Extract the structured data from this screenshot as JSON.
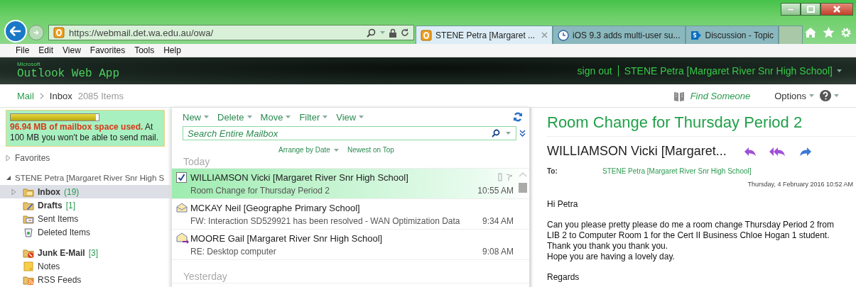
{
  "browser": {
    "address_host": "https://webmail.det.wa.edu.au/owa/",
    "tabs": [
      {
        "label": "STENE Petra [Margaret ...",
        "selected": true,
        "kind": "outlook"
      },
      {
        "label": "iOS 9.3 adds multi-user su...",
        "selected": false,
        "kind": "clock"
      },
      {
        "label": "Discussion - Topic",
        "selected": false,
        "kind": "sharepoint"
      }
    ],
    "menu": [
      "File",
      "Edit",
      "View",
      "Favorites",
      "Tools",
      "Help"
    ]
  },
  "app": {
    "brand_small": "Microsoft",
    "brand": "Outlook Web App",
    "sign_out": "sign out",
    "user": "STENE Petra [Margaret River Snr High School]"
  },
  "breadcrumb": {
    "root": "Mail",
    "folder": "Inbox",
    "count": "2085 Items"
  },
  "top_links": {
    "find": "Find Someone",
    "options": "Options"
  },
  "quota": {
    "level": 0.97,
    "warning": "**96.94 MB of mailbox space used.** At 100 MB you won't be able to send mail."
  },
  "sidebar": {
    "favorites": {
      "label": "Favorites",
      "expanded": false
    },
    "mailbox": {
      "label": "STENE Petra [Margaret River Snr High S",
      "expanded": true,
      "folders": [
        {
          "name": "Inbox",
          "count": "(19)",
          "kind": "inbox",
          "bold": true,
          "selected": true,
          "gap_before": false,
          "has_children": true
        },
        {
          "name": "Drafts",
          "count": "[1]",
          "kind": "drafts",
          "bold": true,
          "selected": false,
          "gap_before": false,
          "has_children": false
        },
        {
          "name": "Sent Items",
          "kind": "sent",
          "bold": false,
          "selected": false,
          "gap_before": false,
          "has_children": false
        },
        {
          "name": "Deleted Items",
          "kind": "deleted",
          "bold": false,
          "selected": false,
          "gap_before": false,
          "has_children": false
        },
        {
          "name": "Junk E-Mail",
          "count": "[3]",
          "kind": "junk",
          "bold": true,
          "selected": false,
          "gap_before": true,
          "has_children": false
        },
        {
          "name": "Notes",
          "kind": "notes",
          "bold": false,
          "selected": false,
          "gap_before": false,
          "has_children": false
        },
        {
          "name": "RSS Feeds",
          "kind": "rss",
          "bold": false,
          "selected": false,
          "gap_before": false,
          "has_children": false
        }
      ]
    }
  },
  "toolbar": [
    "New",
    "Delete",
    "Move",
    "Filter",
    "View"
  ],
  "search": {
    "placeholder": "Search Entire Mailbox"
  },
  "arrange": {
    "by": "Arrange by Date",
    "order": "Newest on Top"
  },
  "groups": [
    {
      "label": "Today",
      "messages": [
        {
          "sender": "WILLIAMSON Vicki [Margaret River Snr High School]",
          "subject": "Room Change for Thursday Period 2",
          "time": "10:55 AM",
          "selected": true,
          "kind": "check"
        },
        {
          "sender": "MCKAY Neil [Geographe Primary School]",
          "subject": "FW: Interaction SD529921 has been resolved - WAN Optimization Data",
          "time": "9:34 AM",
          "selected": false,
          "kind": "read"
        },
        {
          "sender": "MOORE Gail [Margaret River Snr High School]",
          "subject": "RE: Desktop computer",
          "time": "9:08 AM",
          "selected": false,
          "kind": "reply"
        }
      ]
    },
    {
      "label": "Yesterday"
    }
  ],
  "reading": {
    "subject": "Room Change for Thursday Period 2",
    "from": "WILLIAMSON Vicki [Margaret...",
    "to_label": "To:",
    "to": "STENE Petra [Margaret River Snr High School]",
    "date": "Thursday, 4 February 2016 10:52 AM",
    "paragraphs": [
      [
        "Hi Petra"
      ],
      [
        "Can you please pretty please do me a room change Thursday Period 2 from LIB 2 to Computer Room 1 for the Cert II Business Chloe Hogan 1 student.",
        "Thank you thank you thank you.",
        "Hope you are having a lovely day."
      ],
      [
        "Regards"
      ]
    ]
  }
}
